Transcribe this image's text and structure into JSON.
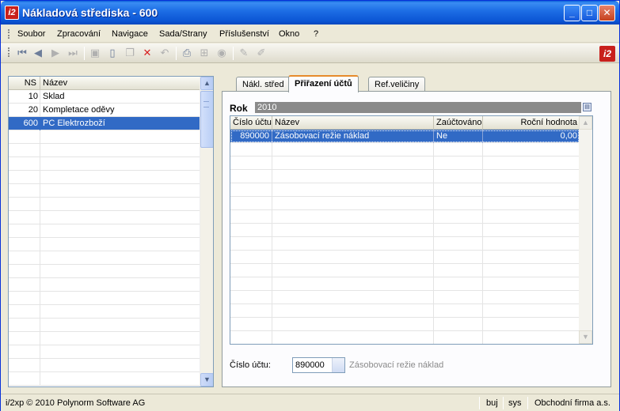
{
  "window": {
    "title": "Nákladová střediska - 600",
    "logo_text": "i2"
  },
  "menu": [
    "Soubor",
    "Zpracování",
    "Navigace",
    "Sada/Strany",
    "Příslušenství",
    "Okno",
    "?"
  ],
  "toolbar": {
    "icons": [
      "first-record-icon",
      "prev-record-icon",
      "next-record-icon",
      "last-record-icon",
      "save-icon",
      "new-icon",
      "copy-icon",
      "delete-icon",
      "undo-icon",
      "print-icon",
      "tree-icon",
      "find-icon",
      "edit-icon",
      "edit-alt-icon"
    ]
  },
  "left_grid": {
    "columns": {
      "ns": "NS",
      "name": "Název"
    },
    "rows": [
      {
        "ns": "10",
        "name": "Sklad"
      },
      {
        "ns": "20",
        "name": "Kompletace oděvy"
      },
      {
        "ns": "600",
        "name": "PC Elektrozboží",
        "selected": true
      }
    ]
  },
  "tabs": [
    "Nákl. střed",
    "Přiřazení účtů",
    "Ref.veličiny"
  ],
  "active_tab": "Přiřazení účtů",
  "rok": {
    "label": "Rok",
    "value": "2010"
  },
  "accounts_grid": {
    "columns": [
      "Číslo účtu",
      "Název",
      "Zaúčtováno",
      "Roční hodnota"
    ],
    "rows": [
      {
        "cislo": "890000",
        "nazev": "Zásobovací režie náklad",
        "zauctovano": "Ne",
        "rocni": "0,00",
        "selected": true
      }
    ]
  },
  "cislo_uctu": {
    "label": "Číslo účtu:",
    "value": "890000",
    "description": "Zásobovací režie náklad"
  },
  "status": {
    "copyright": "i/2xp © 2010 Polynorm Software AG",
    "user": "buj",
    "db": "sys",
    "company": "Obchodní firma a.s."
  },
  "colors": {
    "selection": "#316ac5",
    "titlebar": "#0b55d4",
    "accent_tab": "#e68b2c"
  }
}
